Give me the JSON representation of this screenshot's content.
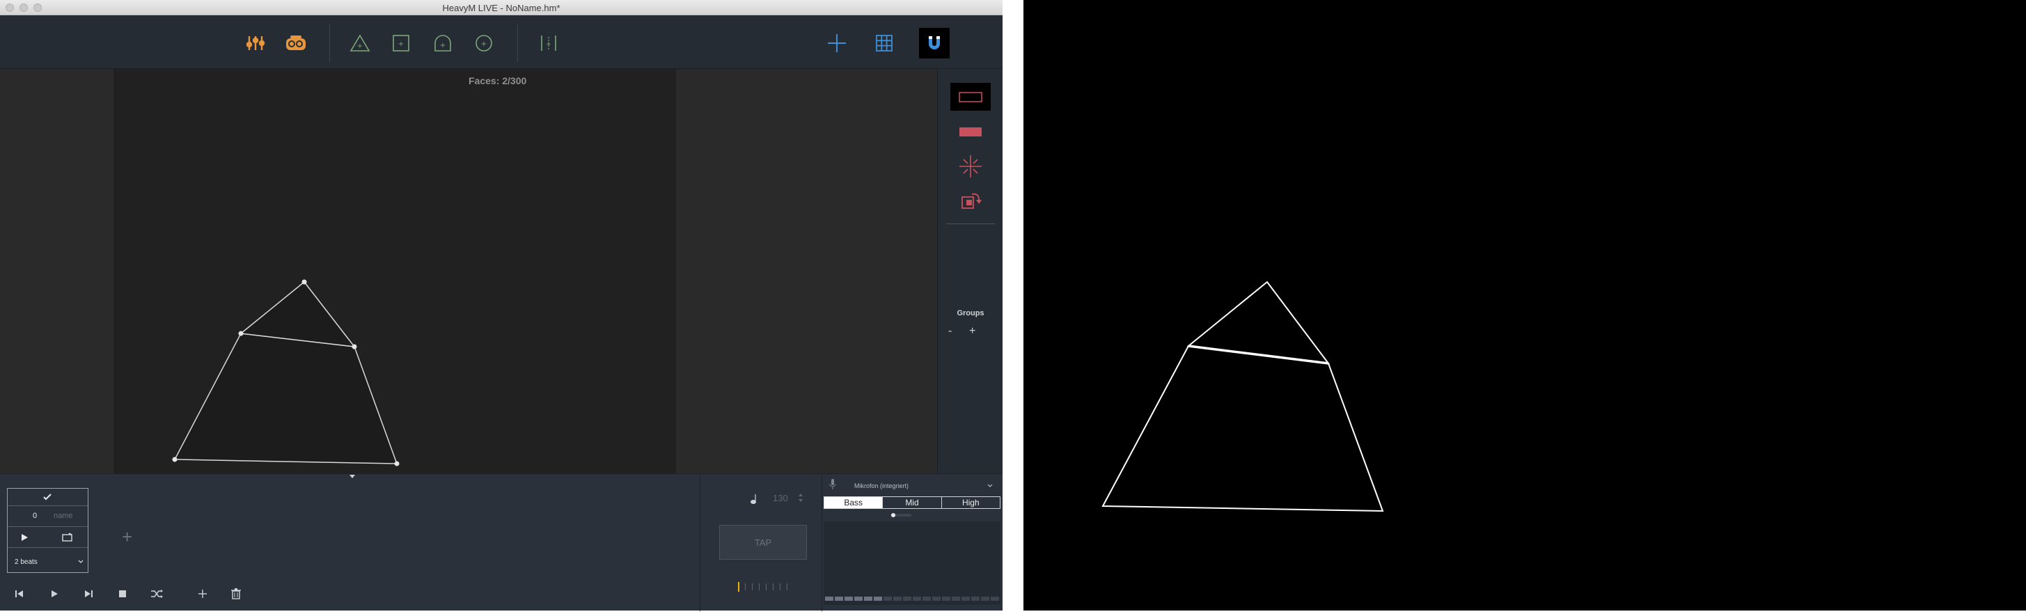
{
  "window": {
    "title": "HeavyM LIVE - NoName.hm*"
  },
  "canvas": {
    "faces_text": "Faces: 2/300"
  },
  "sidepanel": {
    "groups_label": "Groups",
    "groups_remove": "-",
    "groups_add": "+"
  },
  "sequence": {
    "number": "0",
    "name_placeholder": "name",
    "beats_option": "2 beats",
    "add_label": "+"
  },
  "tempo": {
    "bpm": "130",
    "tap_label": "TAP"
  },
  "audio": {
    "input_device": "Mikrofon (integriert)",
    "bands": [
      "Bass",
      "Mid",
      "High"
    ],
    "active_band": "Bass"
  },
  "colors": {
    "toolbar_orange": "#e8963c",
    "shape_green": "#7fa77a",
    "accent_blue": "#3f8ed8",
    "face_red": "#c9505d"
  },
  "icons": {
    "toolbar": [
      "mixer-icon",
      "projector-icon",
      "triangle-add-icon",
      "square-add-icon",
      "dome-add-icon",
      "circle-add-icon",
      "split-icon",
      "crosshair-add-icon",
      "grid-icon",
      "magnet-icon"
    ],
    "side": [
      "outline-rect-icon",
      "filled-rect-icon",
      "sparkle-icon",
      "transform-icon"
    ]
  }
}
